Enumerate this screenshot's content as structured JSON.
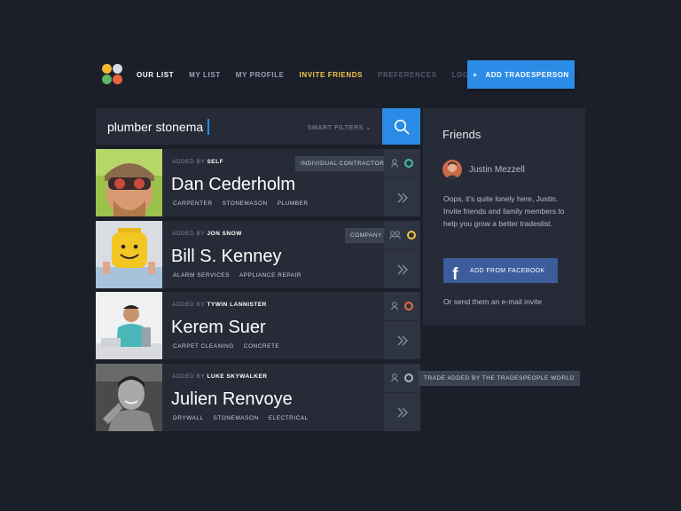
{
  "nav": {
    "items": [
      {
        "label": "OUR LIST",
        "state": "active"
      },
      {
        "label": "MY LIST",
        "state": "normal"
      },
      {
        "label": "MY PROFILE",
        "state": "normal"
      },
      {
        "label": "INVITE FRIENDS",
        "state": "highlight"
      },
      {
        "label": "PREFERENCES",
        "state": "dim"
      },
      {
        "label": "LOGOUT",
        "state": "dim"
      }
    ],
    "add_button": {
      "icon": "+",
      "label": "ADD TRADESPERSON"
    }
  },
  "search": {
    "value": "plumber stonema",
    "smart_filters": "SMART FILTERS",
    "filter_chevron": "⌄"
  },
  "people": [
    {
      "added_by_prefix": "ADDED BY",
      "added_by": "SELF",
      "name": "Dan Cederholm",
      "tags": [
        "CARPENTER",
        "STONEMASON",
        "PLUMBER"
      ],
      "badge": "INDIVIDUAL CONTRACTOR",
      "status_color": "#3fbfa0"
    },
    {
      "added_by_prefix": "ADDED BY",
      "added_by": "JON SNOW",
      "name": "Bill S. Kenney",
      "tags": [
        "ALARM SERVICES",
        "APPLIANCE REPAIR"
      ],
      "badge": "COMPANY",
      "status_color": "#f2c43a"
    },
    {
      "added_by_prefix": "ADDED BY",
      "added_by": "TYWIN LANNISTER",
      "name": "Kerem Suer",
      "tags": [
        "CARPET CLEANING",
        "CONCRETE"
      ],
      "badge": "",
      "status_color": "#e8703c"
    },
    {
      "added_by_prefix": "ADDED BY",
      "added_by": "LUKE SKYWALKER",
      "name": "Julien Renvoye",
      "tags": [
        "DRYWALL",
        "STONEMASON",
        "ELECTRICAL"
      ],
      "badge": "TRADE ADDED BY THE TRADESPEOPLE WORLD",
      "status_color": "#aeb5c2"
    }
  ],
  "friends": {
    "title": "Friends",
    "user": "Justin Mezzell",
    "message": "Oops, it's quite lonely here, Justin. Invite friends and family members to help you grow a better tradeslist.",
    "fb_icon": "f",
    "fb_button": "ADD FROM FACEBOOK",
    "email_invite": "Or send them an e-mail invite"
  }
}
